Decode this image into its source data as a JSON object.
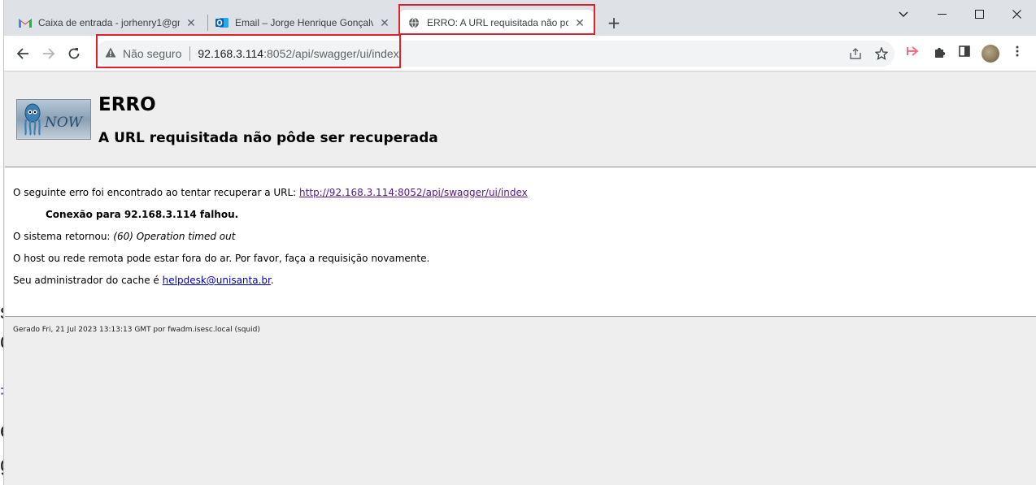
{
  "tabs": [
    {
      "label": "Caixa de entrada - jorhenry1@gm",
      "icon": "gmail-icon",
      "active": false
    },
    {
      "label": "Email – Jorge Henrique Gonçalve",
      "icon": "outlook-icon",
      "active": false
    },
    {
      "label": "ERRO: A URL requisitada não poc",
      "icon": "globe-icon",
      "active": true
    }
  ],
  "window_controls": {
    "minimize": "—",
    "maximize": "☐",
    "close": "✕",
    "dropdown": "⌄"
  },
  "address_bar": {
    "security_label": "Não seguro",
    "host": "92.168.3.114",
    "path": ":8052/api/swagger/ui/index"
  },
  "page": {
    "title": "ERRO",
    "subtitle": "A URL requisitada não pôde ser recuperada",
    "line1_prefix": "O seguinte erro foi encontrado ao tentar recuperar a URL: ",
    "line1_link": "http://92.168.3.114:8052/api/swagger/ui/index",
    "line2": "Conexão para 92.168.3.114 falhou.",
    "line3_prefix": "O sistema retornou: ",
    "line3_error": "(60) Operation timed out",
    "line4": "O host ou rede remota pode estar fora do ar. Por favor, faça a requisição novamente.",
    "line5_prefix": "Seu administrador do cache é ",
    "line5_email": "helpdesk@unisanta.br",
    "line5_suffix": ".",
    "footer": "Gerado Fri, 21 Jul 2023 13:13:13 GMT por fwadm.isesc.local (squid)",
    "logo_text": "NOW"
  },
  "colors": {
    "highlight": "#e0202c",
    "link": "#551a8b",
    "mail_link": "#0000cc"
  }
}
